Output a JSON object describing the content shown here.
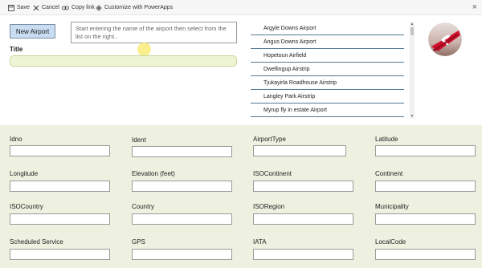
{
  "toolbar": {
    "save": "Save",
    "cancel": "Cancel",
    "copy_link": "Copy link",
    "customize": "Customize with PowerApps"
  },
  "new_airport_button": "New Airport",
  "search_hint": "Start entering the name of the airport then select from the list on the right..",
  "title_label": "Title",
  "airports": [
    "Argyle Downs Airport",
    "Angus Downs Airport",
    "Hopetoun Airfield",
    "Dwellingup Airstrip",
    "Tjukayirla Roadhouse Airstrip",
    "Langley Park Airstrip",
    "Myrup fly in estate Airport"
  ],
  "fields": {
    "idno": "Idno",
    "ident": "Ident",
    "airport_type": "AirportType",
    "latitude": "Latitude",
    "longitude": "Longitude",
    "elevation": "Elevation (feet)",
    "iso_continent": "ISOContinent",
    "continent": "Continent",
    "iso_country": "ISOCountry",
    "country": "Country",
    "iso_region": "ISORegion",
    "municipality": "Municipality",
    "scheduled_service": "Scheduled Service",
    "gps": "GPS",
    "iata": "IATA",
    "local_code": "LocalCode"
  },
  "colors": {
    "form_background": "#eef1e0",
    "title_field": "#eef5d4",
    "button": "#c8ddf1",
    "list_divider": "#567893",
    "logo_red": "#d0112b"
  }
}
